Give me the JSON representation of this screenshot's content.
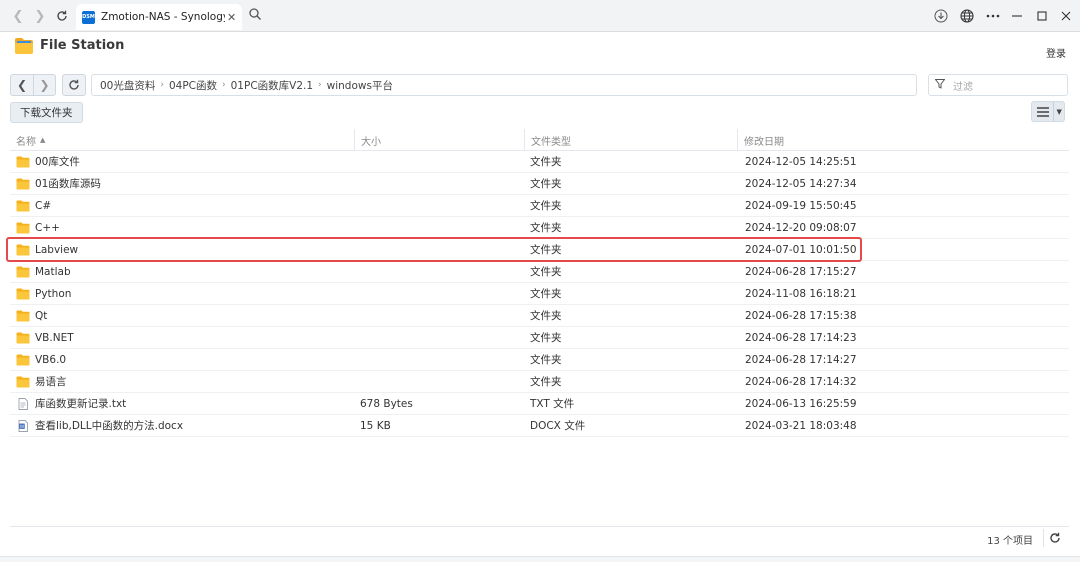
{
  "browser": {
    "tab_title": "Zmotion-NAS - Synology NAS",
    "favicon_text": "DSM",
    "close_glyph": "✕"
  },
  "app": {
    "title": "File Station",
    "login_label": "登录"
  },
  "path": {
    "crumbs": [
      "00光盘资料",
      "04PC函数",
      "01PC函数库V2.1",
      "windows平台"
    ],
    "filter_placeholder": "过滤"
  },
  "toolbar": {
    "download_label": "下载文件夹"
  },
  "table": {
    "headers": {
      "name": "名称",
      "size": "大小",
      "type": "文件类型",
      "modified": "修改日期"
    },
    "rows": [
      {
        "icon": "folder-icon",
        "name": "00库文件",
        "size": "",
        "type": "文件夹",
        "modified": "2024-12-05 14:25:51"
      },
      {
        "icon": "folder-icon",
        "name": "01函数库源码",
        "size": "",
        "type": "文件夹",
        "modified": "2024-12-05 14:27:34"
      },
      {
        "icon": "folder-icon",
        "name": "C#",
        "size": "",
        "type": "文件夹",
        "modified": "2024-09-19 15:50:45"
      },
      {
        "icon": "folder-icon",
        "name": "C++",
        "size": "",
        "type": "文件夹",
        "modified": "2024-12-20 09:08:07"
      },
      {
        "icon": "folder-icon",
        "name": "Labview",
        "size": "",
        "type": "文件夹",
        "modified": "2024-07-01 10:01:50"
      },
      {
        "icon": "folder-icon",
        "name": "Matlab",
        "size": "",
        "type": "文件夹",
        "modified": "2024-06-28 17:15:27"
      },
      {
        "icon": "folder-icon",
        "name": "Python",
        "size": "",
        "type": "文件夹",
        "modified": "2024-11-08 16:18:21"
      },
      {
        "icon": "folder-icon",
        "name": "Qt",
        "size": "",
        "type": "文件夹",
        "modified": "2024-06-28 17:15:38"
      },
      {
        "icon": "folder-icon",
        "name": "VB.NET",
        "size": "",
        "type": "文件夹",
        "modified": "2024-06-28 17:14:23"
      },
      {
        "icon": "folder-icon",
        "name": "VB6.0",
        "size": "",
        "type": "文件夹",
        "modified": "2024-06-28 17:14:27"
      },
      {
        "icon": "folder-icon",
        "name": "易语言",
        "size": "",
        "type": "文件夹",
        "modified": "2024-06-28 17:14:32"
      },
      {
        "icon": "text-file-icon",
        "name": "库函数更新记录.txt",
        "size": "678 Bytes",
        "type": "TXT 文件",
        "modified": "2024-06-13 16:25:59"
      },
      {
        "icon": "word-file-icon",
        "name": "查看lib,DLL中函数的方法.docx",
        "size": "15 KB",
        "type": "DOCX 文件",
        "modified": "2024-03-21 18:03:48"
      }
    ]
  },
  "footer": {
    "item_count": "13 个项目"
  },
  "colors": {
    "highlight": "#e44a4a",
    "folder": "#f6b11a",
    "word_blue": "#2b5cb8"
  }
}
